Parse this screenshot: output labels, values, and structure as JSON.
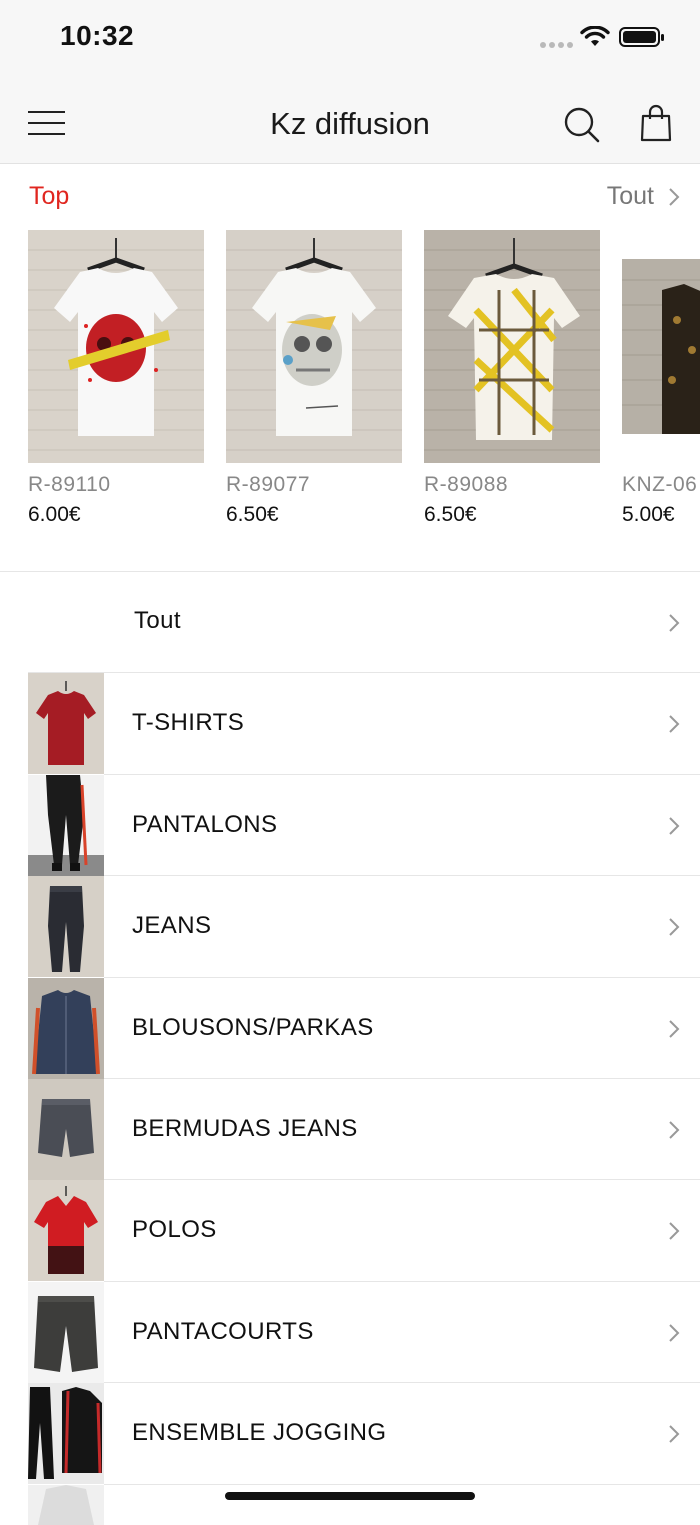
{
  "status": {
    "time": "10:32"
  },
  "nav": {
    "title": "Kz diffusion"
  },
  "top": {
    "label": "Top",
    "all_label": "Tout",
    "products": [
      {
        "ref": "R-89110",
        "price": "6.00€"
      },
      {
        "ref": "R-89077",
        "price": "6.50€"
      },
      {
        "ref": "R-89088",
        "price": "6.50€"
      },
      {
        "ref": "KNZ-06",
        "price": "5.00€"
      }
    ]
  },
  "categories": {
    "all_label": "Tout",
    "items": [
      {
        "label": "T-SHIRTS"
      },
      {
        "label": "PANTALONS"
      },
      {
        "label": "JEANS"
      },
      {
        "label": "BLOUSONS/PARKAS"
      },
      {
        "label": "BERMUDAS JEANS"
      },
      {
        "label": "POLOS"
      },
      {
        "label": "PANTACOURTS"
      },
      {
        "label": "ENSEMBLE JOGGING"
      }
    ]
  },
  "colors": {
    "accent": "#e0261f",
    "muted": "#888888"
  }
}
